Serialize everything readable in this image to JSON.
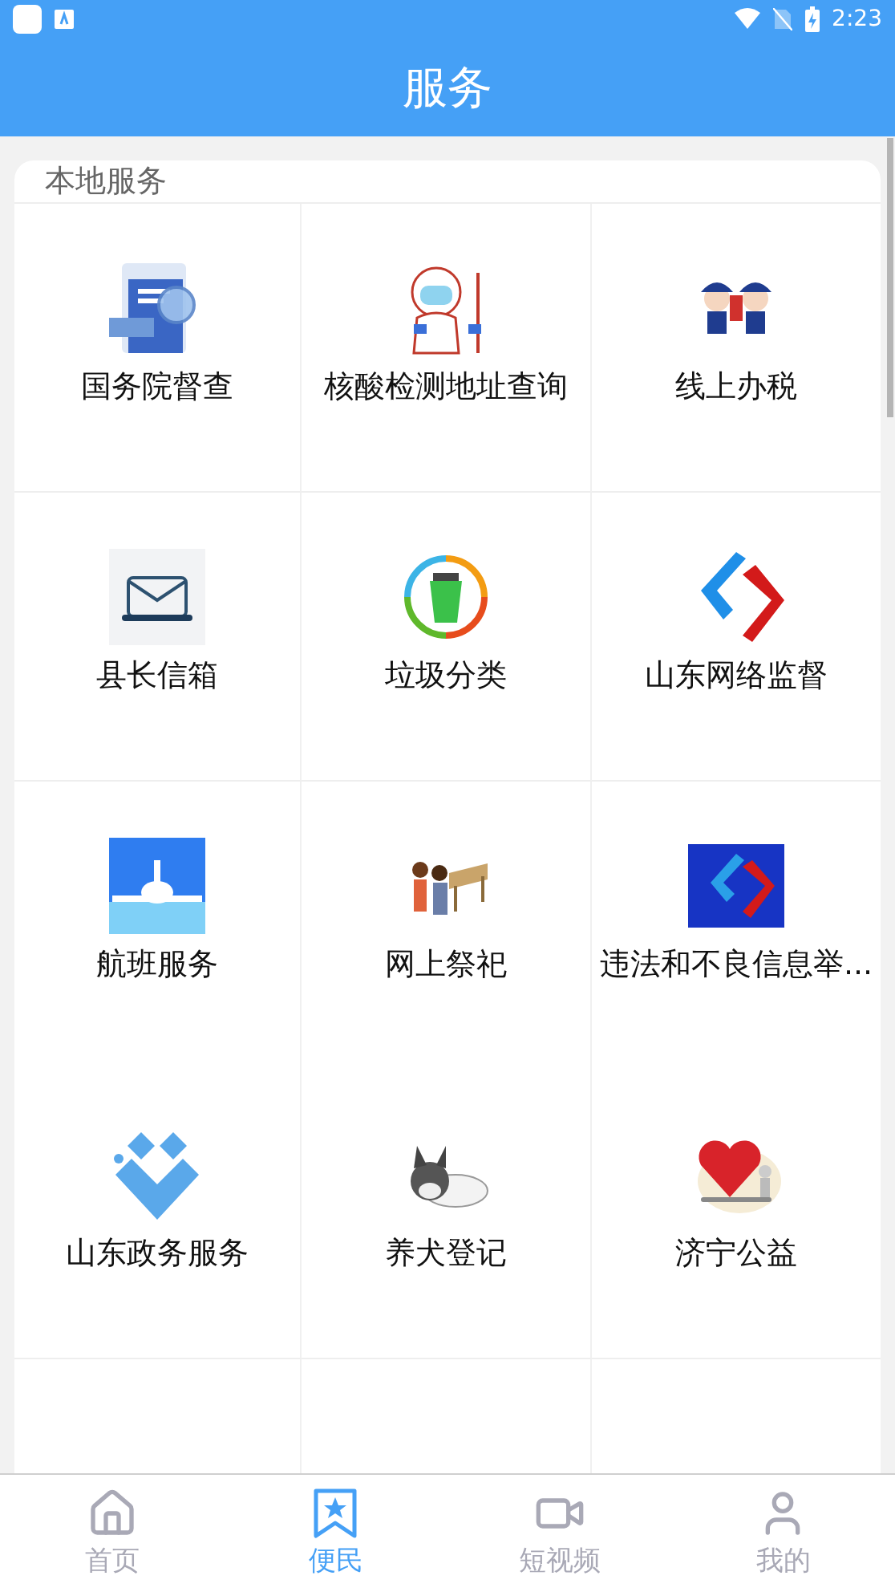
{
  "status_bar": {
    "time": "2:23"
  },
  "header": {
    "title": "服务"
  },
  "section": {
    "title": "本地服务",
    "services": [
      {
        "label": "国务院督查"
      },
      {
        "label": "核酸检测地址查询"
      },
      {
        "label": "线上办税"
      },
      {
        "label": "县长信箱"
      },
      {
        "label": "垃圾分类"
      },
      {
        "label": "山东网络监督"
      },
      {
        "label": "航班服务"
      },
      {
        "label": "网上祭祀"
      },
      {
        "label": "违法和不良信息举..."
      },
      {
        "label": "山东政务服务"
      },
      {
        "label": "养犬登记"
      },
      {
        "label": "济宁公益"
      }
    ]
  },
  "bottom_nav": [
    {
      "label": "首页",
      "selected": false
    },
    {
      "label": "便民",
      "selected": true
    },
    {
      "label": "短视频",
      "selected": false
    },
    {
      "label": "我的",
      "selected": false
    }
  ]
}
